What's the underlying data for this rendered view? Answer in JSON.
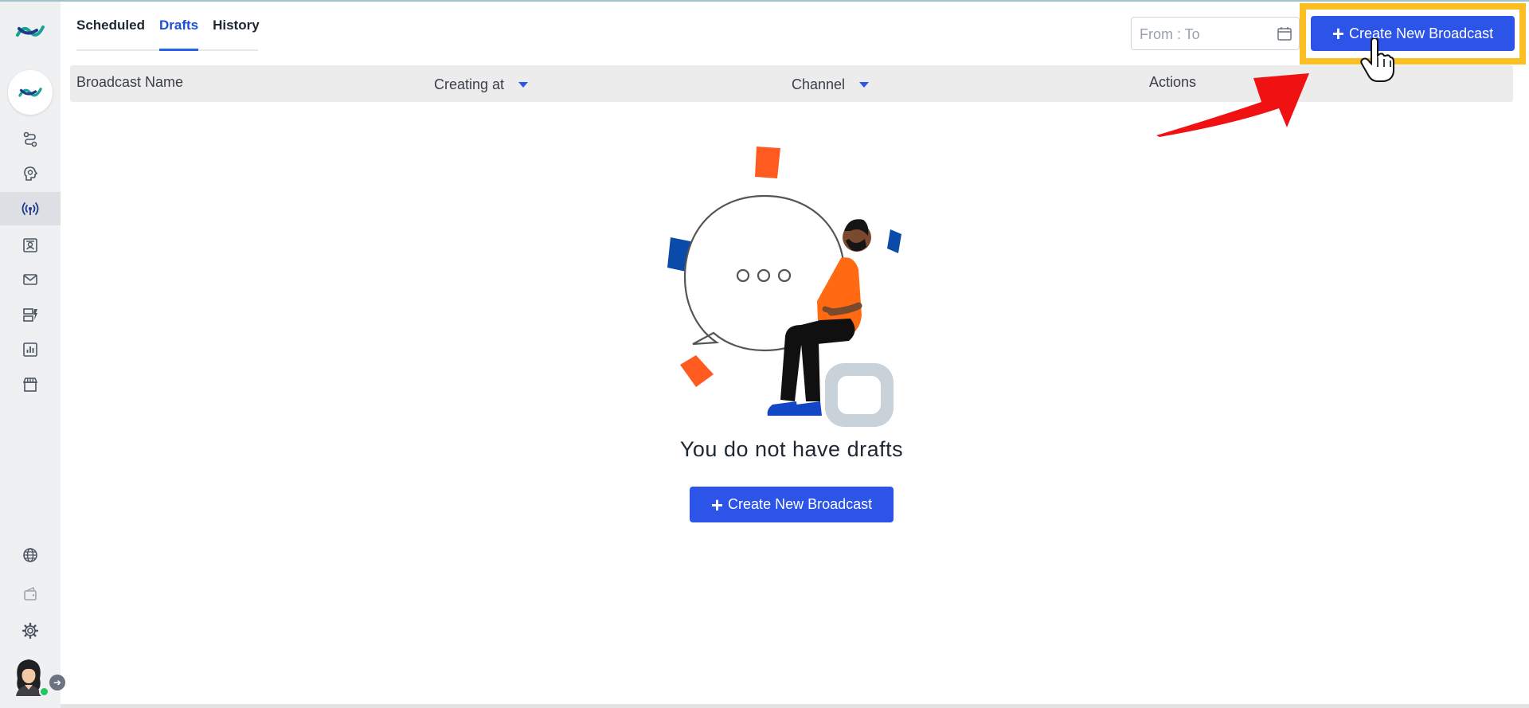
{
  "tabs": [
    {
      "label": "Scheduled",
      "active": false
    },
    {
      "label": "Drafts",
      "active": true
    },
    {
      "label": "History",
      "active": false
    }
  ],
  "date_filter": {
    "placeholder": "From : To"
  },
  "actions": {
    "create_label": "Create New Broadcast"
  },
  "table": {
    "columns": [
      "Broadcast Name",
      "Creating at",
      "Channel",
      "Actions"
    ]
  },
  "empty_state": {
    "message": "You do not have drafts",
    "button_label": "Create New Broadcast"
  },
  "sidebar": {
    "items": [
      {
        "icon": "flow-icon",
        "active": false
      },
      {
        "icon": "bot-brain-icon",
        "active": false
      },
      {
        "icon": "broadcast-icon",
        "active": true
      },
      {
        "icon": "contacts-icon",
        "active": false
      },
      {
        "icon": "mail-icon",
        "active": false
      },
      {
        "icon": "templates-icon",
        "active": false
      },
      {
        "icon": "analytics-icon",
        "active": false
      },
      {
        "icon": "store-icon",
        "active": false
      }
    ],
    "bottom": [
      "globe-icon",
      "wallet-icon",
      "gear-icon"
    ]
  },
  "colors": {
    "primary": "#2c54e8",
    "highlight": "#fbbf24",
    "annotation_arrow": "#f01212",
    "online": "#22c55e"
  }
}
